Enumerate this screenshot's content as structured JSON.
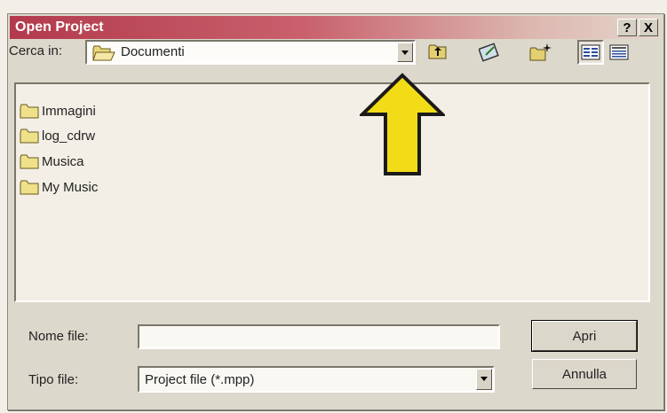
{
  "dialog": {
    "title": "Open Project",
    "help_glyph": "?",
    "close_glyph": "X"
  },
  "look_in": {
    "label": "Cerca in:",
    "value": "Documenti"
  },
  "toolbar": {
    "icons": [
      "up-one-level-icon",
      "desktop-icon",
      "new-folder-icon",
      "list-view-icon",
      "details-view-icon"
    ]
  },
  "files": [
    {
      "label": "Immagini",
      "icon": "folder-icon"
    },
    {
      "label": "log_cdrw",
      "icon": "folder-icon"
    },
    {
      "label": "Musica",
      "icon": "folder-icon"
    },
    {
      "label": "My Music",
      "icon": "folder-icon"
    }
  ],
  "file_name": {
    "label": "Nome file:",
    "value": ""
  },
  "file_type": {
    "label": "Tipo file:",
    "value": "Project file (*.mpp)"
  },
  "buttons": {
    "open": "Apri",
    "cancel": "Annulla"
  },
  "colors": {
    "title_start": "#b23a4c",
    "title_end": "#e4d6cc",
    "callout_arrow": "#f2dc18"
  }
}
